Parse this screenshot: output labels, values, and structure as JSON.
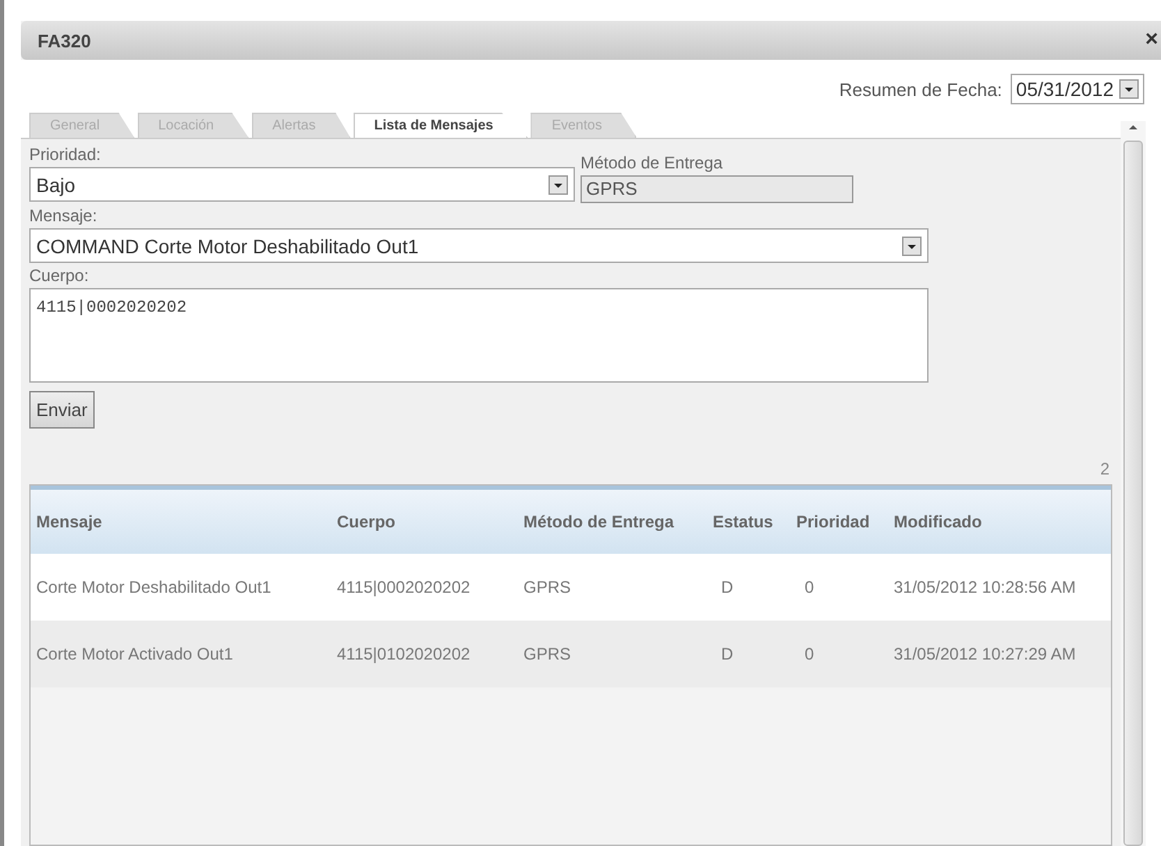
{
  "window": {
    "title": "FA320",
    "close": "×"
  },
  "date_summary": {
    "label": "Resumen de Fecha:",
    "value": "05/31/2012"
  },
  "tabs": [
    {
      "label": "General",
      "selected": false
    },
    {
      "label": "Locación",
      "selected": false
    },
    {
      "label": "Alertas",
      "selected": false
    },
    {
      "label": "Lista de Mensajes",
      "selected": true
    },
    {
      "label": "Eventos",
      "selected": false
    }
  ],
  "form": {
    "priority": {
      "label": "Prioridad:",
      "value": "Bajo"
    },
    "delivery_method": {
      "label": "Método de Entrega",
      "value": "GPRS",
      "disabled": true
    },
    "message": {
      "label": "Mensaje:",
      "value": "COMMAND Corte Motor Deshabilitado Out1"
    },
    "body": {
      "label": "Cuerpo:",
      "value": "4115|0002020202"
    },
    "send_button": "Enviar"
  },
  "count": "2",
  "table": {
    "columns": [
      "Mensaje",
      "Cuerpo",
      "Método de Entrega",
      "Estatus",
      "Prioridad",
      "Modificado"
    ],
    "rows": [
      [
        "Corte Motor Deshabilitado Out1",
        "4115|0002020202",
        "GPRS",
        "D",
        "0",
        "31/05/2012 10:28:56 AM"
      ],
      [
        "Corte Motor Activado Out1",
        "4115|0102020202",
        "GPRS",
        "D",
        "0",
        "31/05/2012 10:27:29 AM"
      ]
    ]
  }
}
